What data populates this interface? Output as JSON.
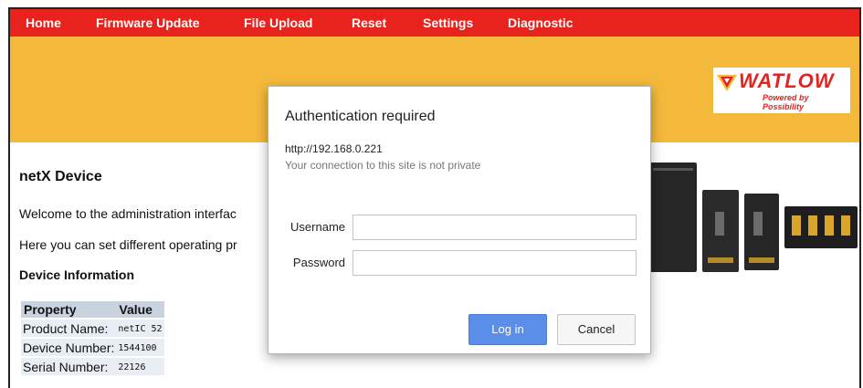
{
  "navbar": {
    "items": [
      {
        "label": "Home"
      },
      {
        "label": "Firmware Update"
      },
      {
        "label": "File Upload"
      },
      {
        "label": "Reset"
      },
      {
        "label": "Settings"
      },
      {
        "label": "Diagnostic"
      }
    ]
  },
  "brand": {
    "name": "WATLOW",
    "tagline": "Powered by Possibility",
    "color": "#e8221c",
    "banner_color": "#f4b93b"
  },
  "page": {
    "title": "netX Device",
    "intro_lines": [
      "Welcome to the administration interfac",
      "Here you can set different operating pr"
    ],
    "section_title": "Device Information"
  },
  "device_table": {
    "headers": [
      "Property",
      "Value"
    ],
    "rows": [
      {
        "property": "Product Name:",
        "value": "netIC 52"
      },
      {
        "property": "Device Number:",
        "value": "1544100"
      },
      {
        "property": "Serial Number:",
        "value": "22126"
      }
    ]
  },
  "auth_dialog": {
    "title": "Authentication required",
    "url": "http://192.168.0.221",
    "warning": "Your connection to this site is not private",
    "username_label": "Username",
    "password_label": "Password",
    "username_value": "",
    "password_value": "",
    "login_label": "Log in",
    "cancel_label": "Cancel"
  }
}
